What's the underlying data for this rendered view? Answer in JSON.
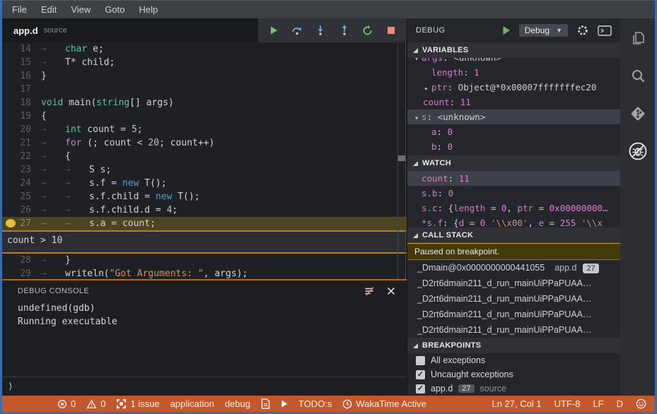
{
  "menubar": {
    "items": [
      "File",
      "Edit",
      "View",
      "Goto",
      "Help"
    ]
  },
  "editor": {
    "tab": {
      "title": "app.d",
      "subtitle": "source"
    },
    "toolbar": [
      "continue",
      "step-over",
      "step-into",
      "step-out",
      "restart",
      "stop"
    ],
    "breakpoint_condition": "count > 10",
    "code_lines": [
      {
        "num": "14",
        "segs": [
          [
            "tab",
            "→"
          ],
          [
            "kw",
            "char"
          ],
          [
            "pl",
            " e;"
          ]
        ]
      },
      {
        "num": "15",
        "segs": [
          [
            "tab",
            "→"
          ],
          [
            "pl",
            "T* child;"
          ]
        ]
      },
      {
        "num": "16",
        "segs": [
          [
            "pl",
            "}"
          ]
        ]
      },
      {
        "num": "17",
        "segs": []
      },
      {
        "num": "18",
        "segs": [
          [
            "kw",
            "void"
          ],
          [
            "pl",
            " main("
          ],
          [
            "kw",
            "string"
          ],
          [
            "pl",
            "[] args)"
          ]
        ]
      },
      {
        "num": "19",
        "segs": [
          [
            "pl",
            "{"
          ]
        ]
      },
      {
        "num": "20",
        "segs": [
          [
            "tab",
            "→"
          ],
          [
            "kw",
            "int"
          ],
          [
            "pl",
            " count = "
          ],
          [
            "num",
            "5"
          ],
          [
            "pl",
            ";"
          ]
        ]
      },
      {
        "num": "21",
        "segs": [
          [
            "tab",
            "→"
          ],
          [
            "ctrl",
            "for"
          ],
          [
            "pl",
            " (; count < "
          ],
          [
            "num",
            "20"
          ],
          [
            "pl",
            "; count++)"
          ]
        ]
      },
      {
        "num": "22",
        "segs": [
          [
            "tab",
            "→"
          ],
          [
            "pl",
            "{"
          ]
        ]
      },
      {
        "num": "23",
        "segs": [
          [
            "tab",
            "→"
          ],
          [
            "tab",
            "→"
          ],
          [
            "pl",
            "S s;"
          ]
        ]
      },
      {
        "num": "24",
        "segs": [
          [
            "tab",
            "→"
          ],
          [
            "tab",
            "→"
          ],
          [
            "pl",
            "s.f = "
          ],
          [
            "new",
            "new"
          ],
          [
            "pl",
            " T();"
          ]
        ]
      },
      {
        "num": "25",
        "segs": [
          [
            "tab",
            "→"
          ],
          [
            "tab",
            "→"
          ],
          [
            "pl",
            "s.f.child = "
          ],
          [
            "new",
            "new"
          ],
          [
            "pl",
            " T();"
          ]
        ]
      },
      {
        "num": "26",
        "segs": [
          [
            "tab",
            "→"
          ],
          [
            "tab",
            "→"
          ],
          [
            "pl",
            "s.f.child.d = "
          ],
          [
            "num",
            "4"
          ],
          [
            "pl",
            ";"
          ]
        ]
      },
      {
        "num": "27",
        "current": true,
        "breakpoint": true,
        "widget_after": true,
        "segs": [
          [
            "tab",
            "→"
          ],
          [
            "tab",
            "→"
          ],
          [
            "pl",
            "s.a = count;"
          ]
        ]
      },
      {
        "num": "28",
        "segs": [
          [
            "tab",
            "→"
          ],
          [
            "pl",
            "}"
          ]
        ]
      },
      {
        "num": "29",
        "segs": [
          [
            "tab",
            "→"
          ],
          [
            "pl",
            "writeln("
          ],
          [
            "str",
            "\"Got Arguments: \""
          ],
          [
            "pl",
            ", args);"
          ]
        ]
      }
    ]
  },
  "console": {
    "title": "DEBUG CONSOLE",
    "lines": [
      "undefined(gdb)",
      "Running executable"
    ],
    "prompt": "⟩"
  },
  "sidebar": {
    "title": "DEBUG",
    "config": "Debug",
    "sections": {
      "variables": "VARIABLES",
      "watch": "WATCH",
      "call_stack": "CALL STACK",
      "breakpoints": "BREAKPOINTS"
    },
    "variables_rows": [
      {
        "indent": 1,
        "arrow": "▾",
        "clipped": true,
        "segs": [
          [
            "nm",
            "args"
          ],
          [
            "pl",
            ": "
          ],
          [
            "pl",
            "<unknown>"
          ]
        ]
      },
      {
        "indent": 2,
        "segs": [
          [
            "nm",
            "length"
          ],
          [
            "pl",
            ": "
          ],
          [
            "nv",
            "1"
          ]
        ]
      },
      {
        "indent": 2,
        "arrow": "▸",
        "segs": [
          [
            "nm",
            "ptr"
          ],
          [
            "pl",
            ": "
          ],
          [
            "pl",
            "Object@*0x00007fffffffec20"
          ]
        ]
      },
      {
        "indent": 1,
        "segs": [
          [
            "nm",
            "count"
          ],
          [
            "pl",
            ": "
          ],
          [
            "nv",
            "11"
          ]
        ]
      },
      {
        "indent": 1,
        "arrow": "▾",
        "selected": true,
        "segs": [
          [
            "nm",
            "s"
          ],
          [
            "pl",
            ": "
          ],
          [
            "pl",
            "<unknown>"
          ]
        ]
      },
      {
        "indent": 2,
        "segs": [
          [
            "nm",
            "a"
          ],
          [
            "pl",
            ": "
          ],
          [
            "nv",
            "0"
          ]
        ]
      },
      {
        "indent": 2,
        "segs": [
          [
            "nm",
            "b"
          ],
          [
            "pl",
            ": "
          ],
          [
            "nv",
            "0"
          ]
        ]
      }
    ],
    "watch_rows": [
      {
        "selected": true,
        "segs": [
          [
            "nm",
            "count"
          ],
          [
            "pl",
            ": "
          ],
          [
            "nv",
            "11"
          ]
        ]
      },
      {
        "segs": [
          [
            "nm",
            "s.b"
          ],
          [
            "pl",
            ": "
          ],
          [
            "nv",
            "0"
          ]
        ]
      },
      {
        "segs": [
          [
            "nm",
            "s.c"
          ],
          [
            "pl",
            ": {"
          ],
          [
            "nm",
            "length"
          ],
          [
            "pl",
            " = "
          ],
          [
            "nv",
            "0"
          ],
          [
            "pl",
            ", "
          ],
          [
            "nm",
            "ptr"
          ],
          [
            "pl",
            " = "
          ],
          [
            "nv",
            "0x00000000…"
          ]
        ]
      },
      {
        "segs": [
          [
            "nm",
            "*s.f"
          ],
          [
            "pl",
            ": {"
          ],
          [
            "nm",
            "d"
          ],
          [
            "pl",
            " = "
          ],
          [
            "nv",
            "0"
          ],
          [
            "pl",
            " "
          ],
          [
            "str",
            "'\\\\x00'"
          ],
          [
            "pl",
            ", "
          ],
          [
            "nm",
            "e"
          ],
          [
            "pl",
            " = "
          ],
          [
            "nv",
            "255"
          ],
          [
            "pl",
            " "
          ],
          [
            "str",
            "'\\\\x"
          ]
        ]
      }
    ],
    "call_stack": {
      "banner": "Paused on breakpoint.",
      "frames": [
        {
          "name": "_Dmain@0x0000000000441055",
          "file": "app.d",
          "line": "27"
        },
        {
          "name": "_D2rt6dmain211_d_run_mainUiPPaPUAA…"
        },
        {
          "name": "_D2rt6dmain211_d_run_mainUiPPaPUAA…"
        },
        {
          "name": "_D2rt6dmain211_d_run_mainUiPPaPUAA…"
        },
        {
          "name": "_D2rt6dmain211_d_run_mainUiPPaPUAA…"
        }
      ]
    },
    "breakpoints": [
      {
        "checked": false,
        "label": "All exceptions"
      },
      {
        "checked": true,
        "label": "Uncaught exceptions"
      },
      {
        "checked": true,
        "label": "app.d",
        "badge": "27",
        "detail": "source"
      }
    ]
  },
  "activitybar": {
    "items": [
      {
        "icon": "files"
      },
      {
        "icon": "search"
      },
      {
        "icon": "git-branch"
      },
      {
        "icon": "debug",
        "active": true
      }
    ]
  },
  "statusbar": {
    "left": [
      {
        "icon": "error",
        "text": "0",
        "name": "errors-indicator"
      },
      {
        "icon": "warning",
        "text": "0",
        "name": "warnings-indicator"
      },
      {
        "icon": "issues",
        "text": "1 issue",
        "name": "issues-indicator"
      },
      {
        "text": "application",
        "name": "status-application"
      },
      {
        "text": "debug",
        "name": "status-debug"
      },
      {
        "icon": "doc",
        "name": "project-file-indicator"
      },
      {
        "icon": "play",
        "name": "run-indicator"
      },
      {
        "text": "TODO:s",
        "name": "status-todos"
      },
      {
        "icon": "clock",
        "text": "WakaTime Active",
        "name": "wakatime-indicator"
      }
    ],
    "right": [
      {
        "text": "Ln 27, Col 1",
        "name": "cursor-position"
      },
      {
        "text": "UTF-8",
        "name": "encoding-indicator"
      },
      {
        "text": "LF",
        "name": "eol-indicator"
      },
      {
        "text": "D",
        "name": "language-mode"
      },
      {
        "icon": "smiley",
        "name": "feedback-smiley"
      }
    ]
  },
  "colors": {
    "window_border_blue": "#3a6cb4",
    "status_orange": "#c4582d",
    "breakpoint_yellow": "#e8bd3b",
    "current_line_olive": "#4a4621",
    "widget_border_orange": "#bd7d16"
  }
}
